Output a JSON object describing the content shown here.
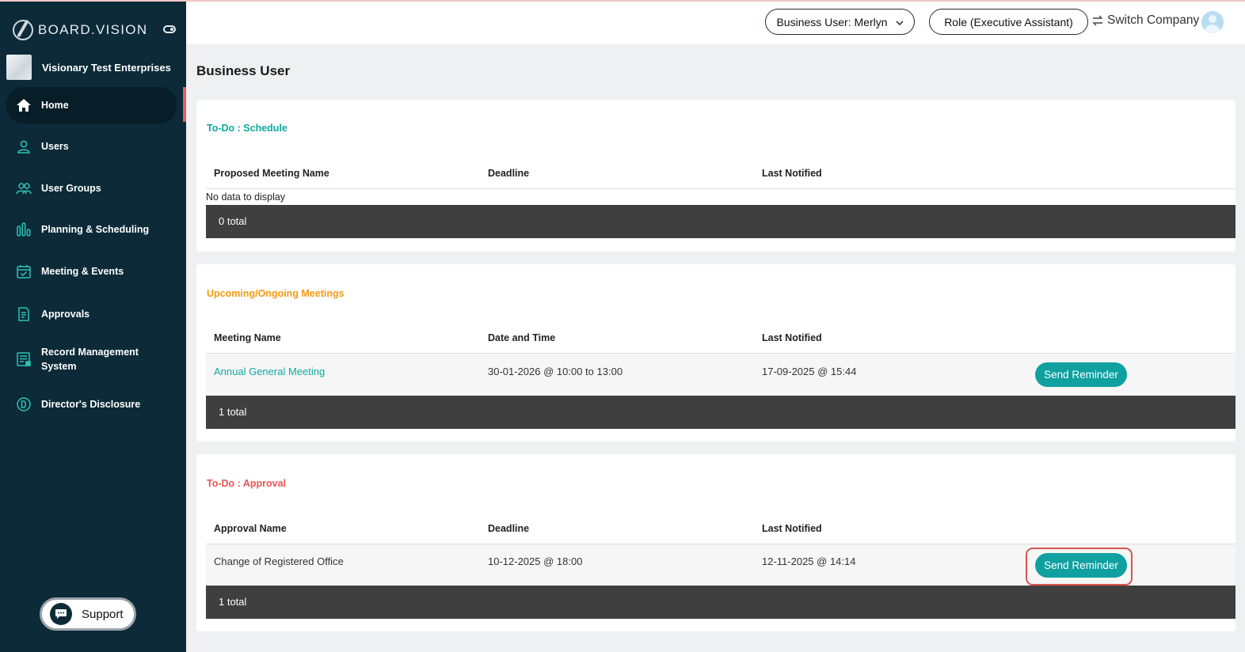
{
  "brand": {
    "name": "BOARD.VISION"
  },
  "company": {
    "name": "Visionary Test Enterprises"
  },
  "sidebar": {
    "items": [
      {
        "label": "Home",
        "icon": "home-icon"
      },
      {
        "label": "Users",
        "icon": "user-icon"
      },
      {
        "label": "User Groups",
        "icon": "users-icon"
      },
      {
        "label": "Planning & Scheduling",
        "icon": "bar-chart-icon"
      },
      {
        "label": "Meeting & Events",
        "icon": "calendar-check-icon"
      },
      {
        "label": "Approvals",
        "icon": "document-icon"
      },
      {
        "label": "Record Management System",
        "icon": "records-icon"
      },
      {
        "label": "Director's Disclosure",
        "icon": "d-circle-icon"
      }
    ],
    "support_label": "Support"
  },
  "header": {
    "user_selector": "Business User: Merlyn",
    "role": "Role (Executive Assistant)",
    "switch_company": "Switch Company"
  },
  "page": {
    "title": "Business User"
  },
  "sections": {
    "schedule": {
      "title": "To-Do : Schedule",
      "columns": [
        "Proposed Meeting Name",
        "Deadline",
        "Last Notified"
      ],
      "empty_text": "No data to display",
      "total": "0 total"
    },
    "meetings": {
      "title": "Upcoming/Ongoing Meetings",
      "columns": [
        "Meeting Name",
        "Date and Time",
        "Last Notified"
      ],
      "rows": [
        {
          "name": "Annual General Meeting",
          "datetime": "30-01-2026 @ 10:00 to 13:00",
          "last_notified": "17-09-2025 @ 15:44",
          "action": "Send Reminder"
        }
      ],
      "total": "1 total"
    },
    "approval": {
      "title": "To-Do : Approval",
      "columns": [
        "Approval Name",
        "Deadline",
        "Last Notified"
      ],
      "rows": [
        {
          "name": "Change of Registered Office",
          "deadline": "10-12-2025 @ 18:00",
          "last_notified": "12-11-2025 @ 14:14",
          "action": "Send Reminder"
        }
      ],
      "total": "1 total"
    }
  },
  "colors": {
    "sidebar_bg": "#0c2a38",
    "accent_teal": "#10a0a0",
    "schedule_title": "#10a8a0",
    "meetings_title": "#f39c12",
    "approval_title": "#ea5455",
    "table_footer": "#3f3f3f",
    "highlight": "#d9534f"
  }
}
